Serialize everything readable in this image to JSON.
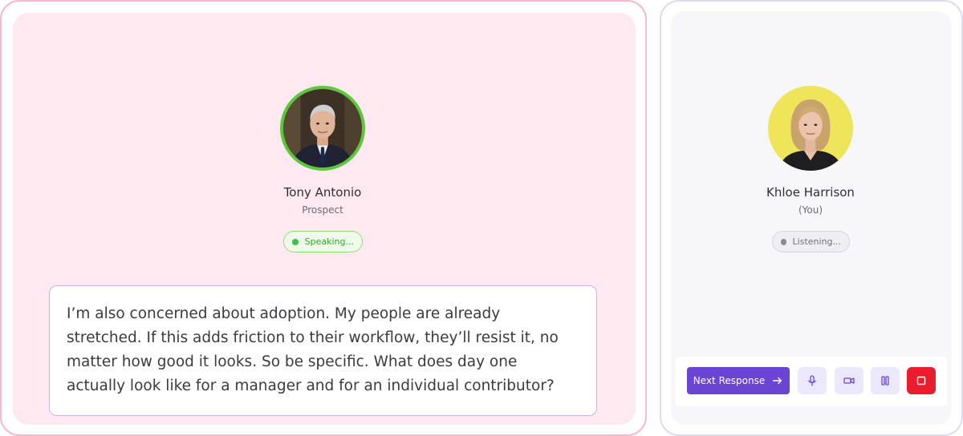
{
  "prospect": {
    "name": "Tony Antonio",
    "role": "Prospect",
    "status": "Speaking...",
    "avatar_ring_color": "#5cc93d"
  },
  "user": {
    "name": "Khloe Harrison",
    "role": "(You)",
    "status": "Listening...",
    "avatar_bg_color": "#efe55a"
  },
  "transcript": {
    "text": "I’m also concerned about adoption. My people are already stretched. If this adds friction to their workflow, they’ll resist it, no matter how good it looks. So be specific. What does day one actually look like for a manager and for an individual contributor?"
  },
  "controls": {
    "next_label": "Next Response",
    "next_icon": "arrow-right-icon",
    "mic_icon": "mic-icon",
    "camera_icon": "video-camera-icon",
    "pause_icon": "pause-icon",
    "stop_icon": "stop-icon",
    "accent_color": "#6a45d3",
    "stop_color": "#ea1d2f"
  }
}
